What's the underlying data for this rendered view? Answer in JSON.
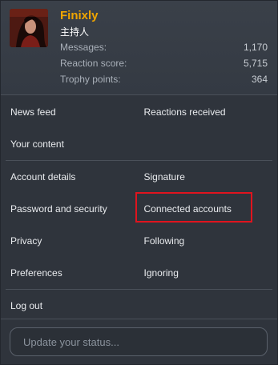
{
  "profile": {
    "username": "Finixly",
    "user_title": "主持人",
    "stats": [
      {
        "label": "Messages:",
        "value": "1,170"
      },
      {
        "label": "Reaction score:",
        "value": "5,715"
      },
      {
        "label": "Trophy points:",
        "value": "364"
      }
    ]
  },
  "links": {
    "news_feed": "News feed",
    "reactions_received": "Reactions received",
    "your_content": "Your content",
    "account_details": "Account details",
    "signature": "Signature",
    "password_security": "Password and security",
    "connected_accounts": "Connected accounts",
    "privacy": "Privacy",
    "following": "Following",
    "preferences": "Preferences",
    "ignoring": "Ignoring",
    "log_out": "Log out"
  },
  "status": {
    "placeholder": "Update your status..."
  },
  "colors": {
    "username": "#f0a500",
    "highlight": "#e0141e",
    "background": "#2f343c"
  }
}
